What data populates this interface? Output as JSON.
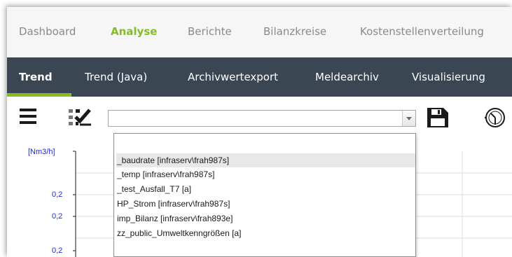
{
  "topnav": {
    "items": [
      "Dashboard",
      "Analyse",
      "Berichte",
      "Bilanzkreise",
      "Kostenstellenverteilung"
    ],
    "active": "Analyse"
  },
  "subnav": {
    "items": [
      "Trend",
      "Trend (Java)",
      "Archivwertexport",
      "Meldearchiv",
      "Visualisierung"
    ],
    "active": "Trend"
  },
  "toolbar": {
    "combo_value": "",
    "icons": [
      "menu-icon",
      "checklist-icon",
      "save-icon",
      "clock-icon"
    ]
  },
  "dropdown": {
    "options": [
      "_baudrate [infraserv\\frah987s]",
      "_temp [infraserv\\frah987s]",
      "_test_Ausfall_T7 [a]",
      "HP_Strom [infraserv\\frah987s]",
      "imp_Bilanz [infraserv\\frah893e]",
      "zz_public_Umweltkenngrößen [a]"
    ],
    "highlighted_index": 0
  },
  "chart": {
    "unit": "[Nm3/h]",
    "ticks": [
      "0,2",
      "0,2",
      "0,2"
    ]
  },
  "colors": {
    "accent": "#86bc25",
    "subnav_bg": "#3a4652",
    "axis_label": "#1a2ad6"
  }
}
